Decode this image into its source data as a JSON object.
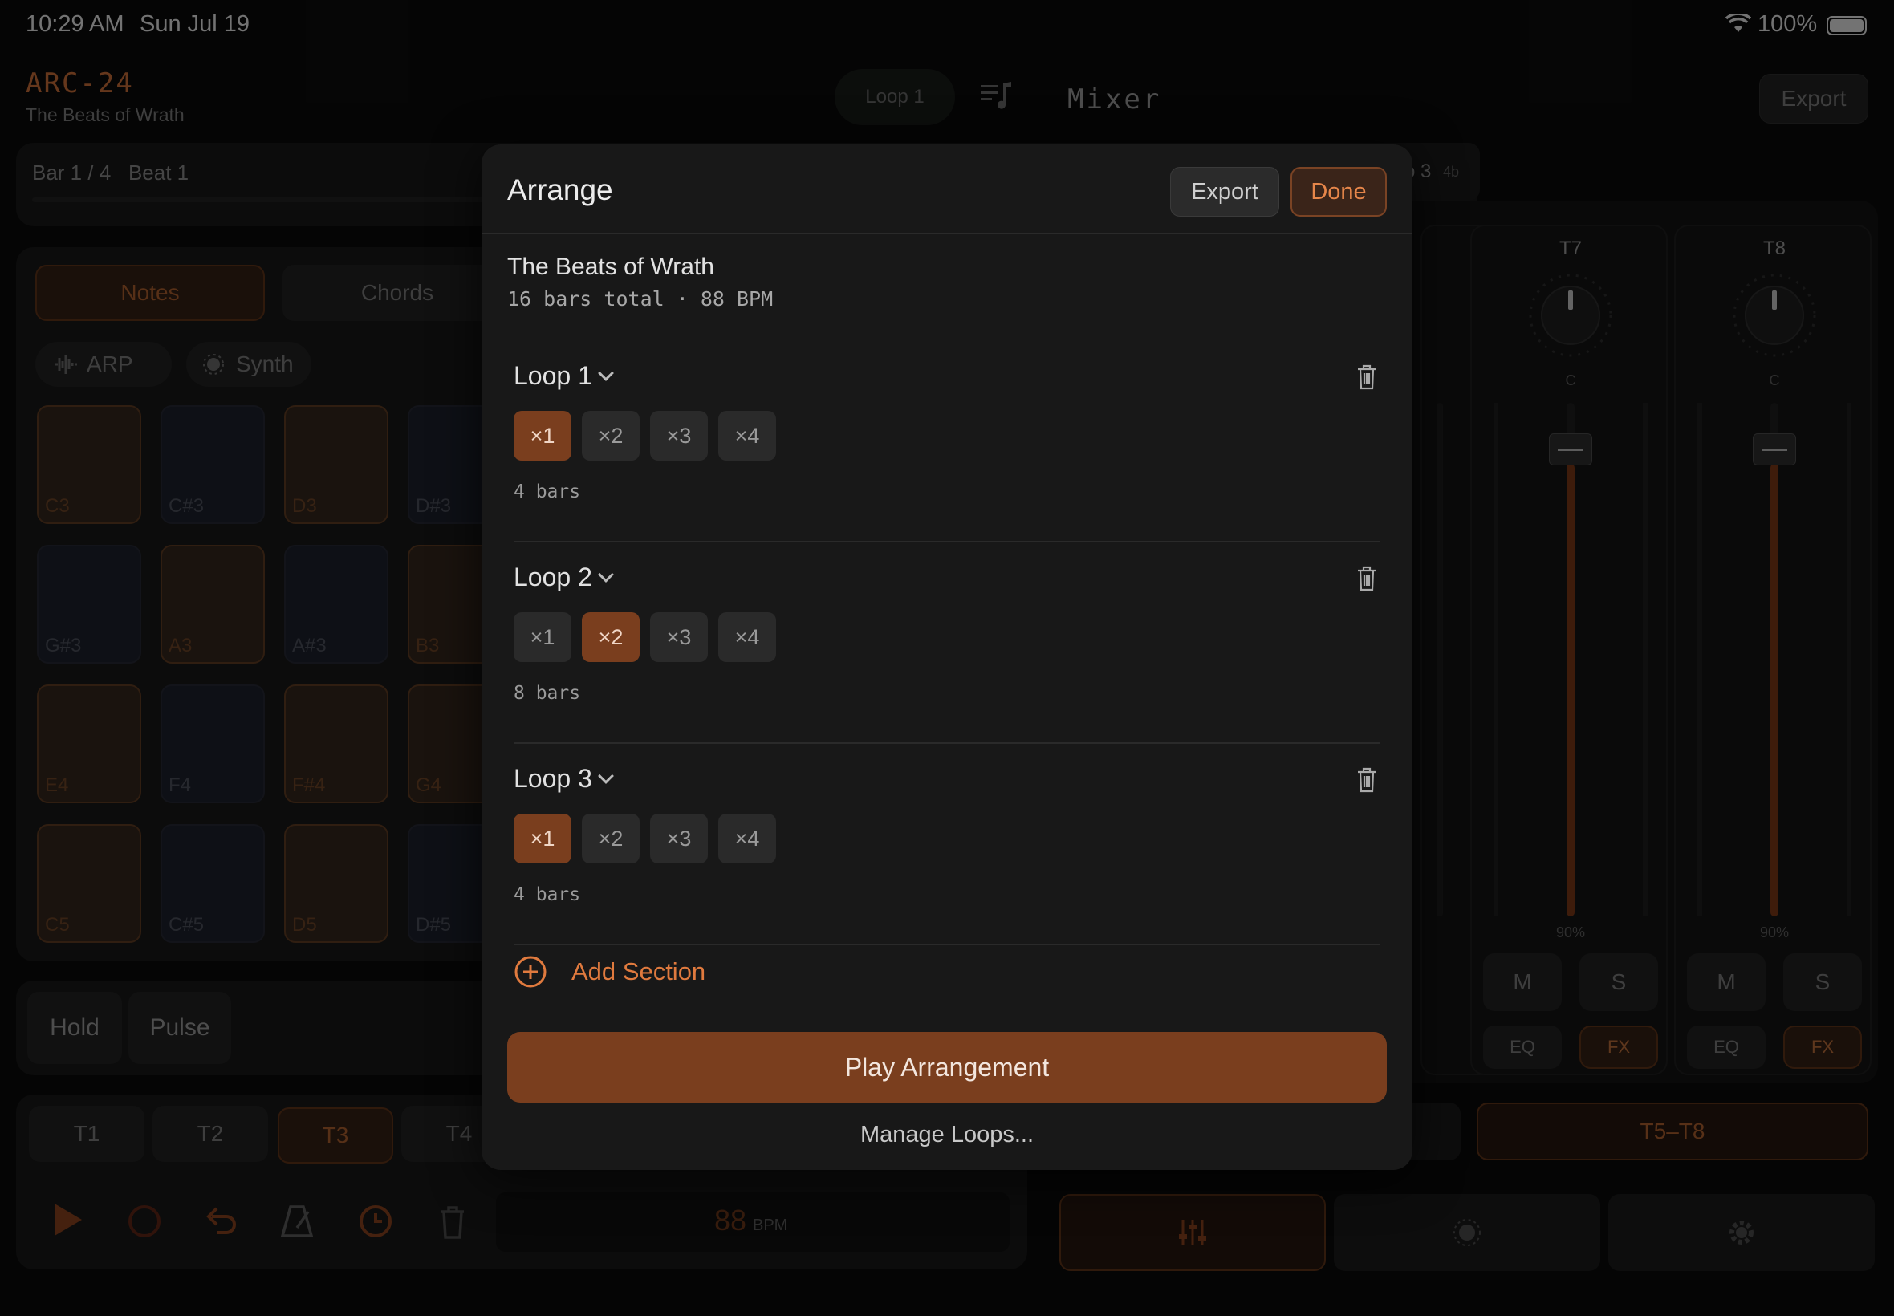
{
  "status_bar": {
    "time": "10:29 AM",
    "date": "Sun Jul 19",
    "battery": "100%"
  },
  "app": {
    "name": "ARC-24",
    "project": "The Beats of Wrath",
    "loop_selector": "Loop 1",
    "mixer_title": "Mixer",
    "export_label": "Export",
    "position": "Bar 1 / 4   Beat 1",
    "loop_chip": "o 3",
    "loop_chip_sub": "4b",
    "mode_tabs": [
      "Notes",
      "Chords"
    ],
    "arp_label": "ARP",
    "synth_label": "Synth",
    "pads": [
      [
        "C3",
        "C#3",
        "D3",
        "D#3"
      ],
      [
        "G#3",
        "A3",
        "A#3",
        "B3"
      ],
      [
        "E4",
        "F4",
        "F#4",
        "G4"
      ],
      [
        "C5",
        "C#5",
        "D5",
        "D#5"
      ]
    ],
    "hold_label": "Hold",
    "pulse_label": "Pulse",
    "track_tabs": [
      "T1",
      "T2",
      "T3",
      "T4"
    ],
    "bpm_value": "88",
    "bpm_unit": "BPM",
    "mixer_strips": [
      {
        "name": "T7",
        "pan": "C",
        "level": "90%",
        "mute": "M",
        "solo": "S",
        "eq": "EQ",
        "fx": "FX"
      },
      {
        "name": "T8",
        "pan": "C",
        "level": "90%",
        "mute": "M",
        "solo": "S",
        "eq": "EQ",
        "fx": "FX"
      }
    ],
    "partial_solo": "S",
    "partial_fx": "X",
    "bank_label": "T5–T8"
  },
  "modal": {
    "title": "Arrange",
    "export_label": "Export",
    "done_label": "Done",
    "song_title": "The Beats of Wrath",
    "song_meta": "16 bars total · 88 BPM",
    "sections": [
      {
        "name": "Loop 1",
        "options": [
          "×1",
          "×2",
          "×3",
          "×4"
        ],
        "selected": 0,
        "bars": "4 bars"
      },
      {
        "name": "Loop 2",
        "options": [
          "×1",
          "×2",
          "×3",
          "×4"
        ],
        "selected": 1,
        "bars": "8 bars"
      },
      {
        "name": "Loop 3",
        "options": [
          "×1",
          "×2",
          "×3",
          "×4"
        ],
        "selected": 0,
        "bars": "4 bars"
      }
    ],
    "add_section_label": "Add Section",
    "play_label": "Play Arrangement",
    "manage_label": "Manage Loops..."
  },
  "colors": {
    "accent": "#e07a3e",
    "accent_fill": "#7a3e1e",
    "modal_bg": "#181818"
  }
}
